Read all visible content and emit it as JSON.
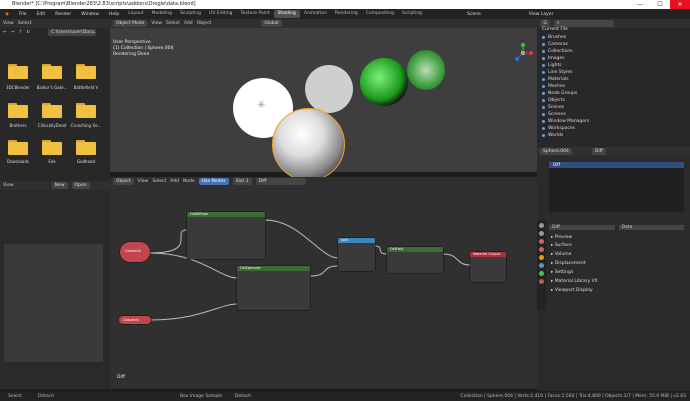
{
  "window": {
    "title": "Blender* [C:\\Program\\Blender283\\2.83\\scripts\\addons\\Drogle\\data.blend]",
    "controls": [
      "—",
      "☐",
      "✕"
    ]
  },
  "menu": {
    "items": [
      "File",
      "Edit",
      "Render",
      "Window",
      "Help"
    ],
    "tabs": [
      "Layout",
      "Modeling",
      "Sculpting",
      "UV Editing",
      "Texture Paint",
      "Shading",
      "Animation",
      "Rendering",
      "Compositing",
      "Scripting"
    ],
    "active_tab": "Shading",
    "scene_label": "Scene",
    "view_layer": "View Layer"
  },
  "file_browser": {
    "header": [
      "View",
      "Select"
    ],
    "path": "C:\\Users\\user\\Docu...",
    "folders": [
      "3DCBlender",
      "Baldur's Gate...",
      "Battlefield V",
      "Brothers",
      "ClinicallyDead",
      "Crunching Xo...",
      "Downloads",
      "Eek",
      "Godhood"
    ]
  },
  "viewport": {
    "mode": "Object Mode",
    "menus": [
      "View",
      "Select",
      "Add",
      "Object"
    ],
    "orientation": "Global",
    "info": [
      "User Perspective",
      "(1) Collection | Sphere.004",
      "Rendering Done"
    ]
  },
  "outliner": {
    "title": "Current File",
    "items": [
      "Brushes",
      "Cameras",
      "Collections",
      "Images",
      "Lights",
      "Line Styles",
      "Materials",
      "Meshes",
      "Node Groups",
      "Objects",
      "Scenes",
      "Screens",
      "Window Managers",
      "Workspaces",
      "Worlds"
    ]
  },
  "properties": {
    "object": "Sphere.004",
    "material": "Diff",
    "slot": "Diff",
    "data": "Data",
    "sections": [
      "Preview",
      "Surface",
      "Volume",
      "Displacement",
      "Settings",
      "Material Library VX",
      "Viewport Display"
    ]
  },
  "node_editor": {
    "header": [
      "Object",
      "View",
      "Select",
      "Add",
      "Node"
    ],
    "use_nodes": "Use Nodes",
    "slot": "Slot 1",
    "material": "Diff",
    "label": "Diff",
    "nodes": {
      "diffuse": "OslDiffuse",
      "specular": "OslSpecular",
      "add": "Add",
      "output": "Material Output",
      "emit": "OslEmit",
      "color_a": "ColorInfo",
      "color_b": "ColorInfo"
    }
  },
  "left_panel": {
    "header": [
      "View"
    ],
    "buttons": [
      "New",
      "Open"
    ]
  },
  "statusbar": {
    "left": [
      "Select",
      "Detach",
      "Box Image Sample",
      "Detach"
    ],
    "right": "Collection | Sphere.004 | Verts:2,410 | Faces:2,560 | Tris:4,800 | Objects:1/7 | Mem: 55.6 MiB | v2.83"
  }
}
